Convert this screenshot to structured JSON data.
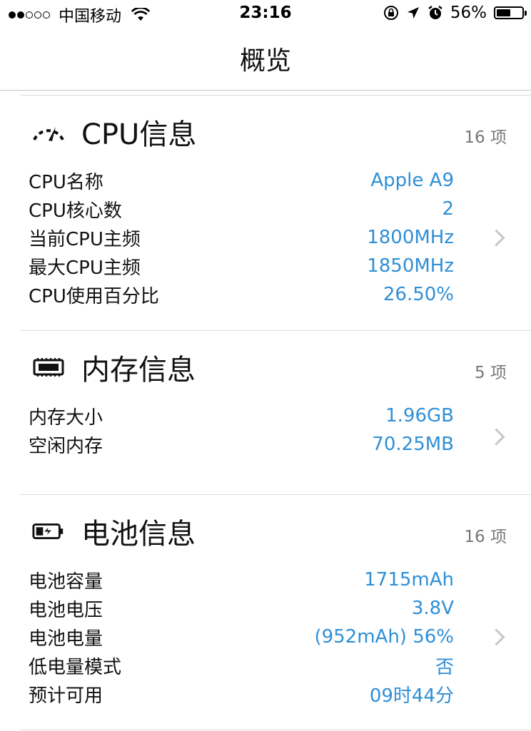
{
  "status_bar": {
    "carrier": "中国移动",
    "time": "23:16",
    "battery_percent": "56%",
    "battery_level": 0.56,
    "signal_bars_filled": 2,
    "signal_bars_total": 5
  },
  "nav": {
    "title": "概览"
  },
  "sections": [
    {
      "title": "CPU信息",
      "count": "16 项",
      "icon": "speedometer-icon",
      "rows": [
        {
          "label": "CPU名称",
          "value": "Apple A9"
        },
        {
          "label": "CPU核心数",
          "value": "2"
        },
        {
          "label": "当前CPU主频",
          "value": "1800MHz"
        },
        {
          "label": "最大CPU主频",
          "value": "1850MHz"
        },
        {
          "label": "CPU使用百分比",
          "value": "26.50%"
        }
      ]
    },
    {
      "title": "内存信息",
      "count": "5 项",
      "icon": "memory-chip-icon",
      "rows": [
        {
          "label": "内存大小",
          "value": "1.96GB"
        },
        {
          "label": "空闲内存",
          "value": "70.25MB"
        }
      ]
    },
    {
      "title": "电池信息",
      "count": "16 项",
      "icon": "battery-charging-icon",
      "rows": [
        {
          "label": "电池容量",
          "value": "1715mAh"
        },
        {
          "label": "电池电压",
          "value": "3.8V"
        },
        {
          "label": "电池电量",
          "value": "(952mAh) 56%"
        },
        {
          "label": "低电量模式",
          "value": "否"
        },
        {
          "label": "预计可用",
          "value": "09时44分"
        }
      ]
    }
  ],
  "colors": {
    "accent": "#2f8fd6",
    "text": "#111111",
    "muted": "#777777",
    "divider": "#dcdcdc",
    "chevron": "#c7c7cc"
  }
}
